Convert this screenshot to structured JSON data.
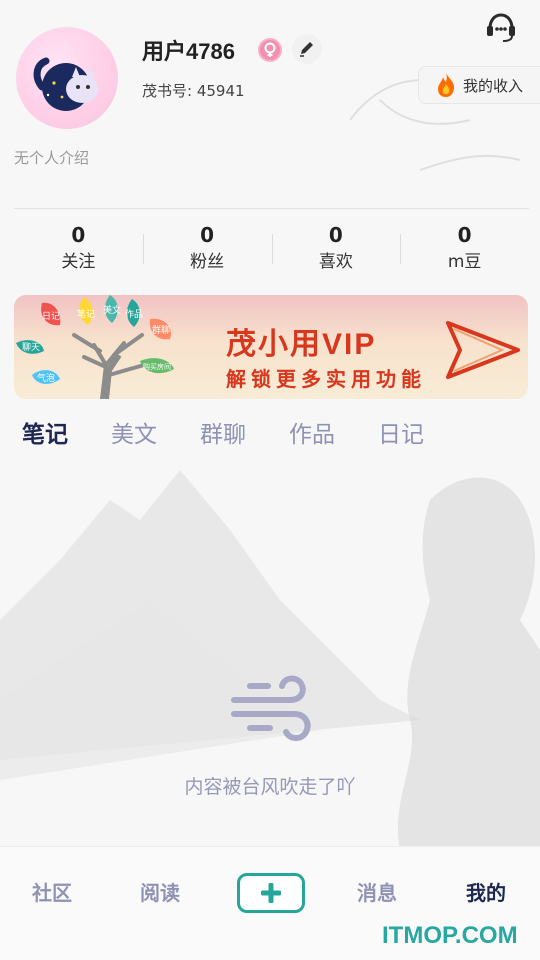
{
  "profile": {
    "username": "用户4786",
    "user_id_label": "茂书号: 45941",
    "bio": "无个人介绍"
  },
  "income_button": {
    "label": "我的收入",
    "icon": "flame-icon"
  },
  "support_icon": "headset-icon",
  "edit_icon": "pencil-icon",
  "badge_icon": "female-badge-icon",
  "stats": [
    {
      "value": "0",
      "label": "关注"
    },
    {
      "value": "0",
      "label": "粉丝"
    },
    {
      "value": "0",
      "label": "喜欢"
    },
    {
      "value": "0",
      "label": "m豆"
    }
  ],
  "vip_banner": {
    "title": "茂小用VIP",
    "subtitle": "解锁更多实用功能",
    "tree_labels": [
      "日记",
      "笔记",
      "美文",
      "作品",
      "群聊",
      "聊天",
      "气泡",
      "购买房间"
    ]
  },
  "tabs": [
    {
      "label": "笔记",
      "active": true
    },
    {
      "label": "美文",
      "active": false
    },
    {
      "label": "群聊",
      "active": false
    },
    {
      "label": "作品",
      "active": false
    },
    {
      "label": "日记",
      "active": false
    }
  ],
  "empty_state": {
    "icon": "wind-icon",
    "text": "内容被台风吹走了吖"
  },
  "bottom_nav": [
    {
      "label": "社区",
      "active": false
    },
    {
      "label": "阅读",
      "active": false
    },
    {
      "label": "+",
      "active": false
    },
    {
      "label": "消息",
      "active": false
    },
    {
      "label": "我的",
      "active": true
    }
  ],
  "watermark": "ITMOP.COM",
  "colors": {
    "accent": "#26a69a",
    "active_text": "#1d2752",
    "inactive_text": "#8f92b4",
    "vip_red": "#d9361e"
  }
}
